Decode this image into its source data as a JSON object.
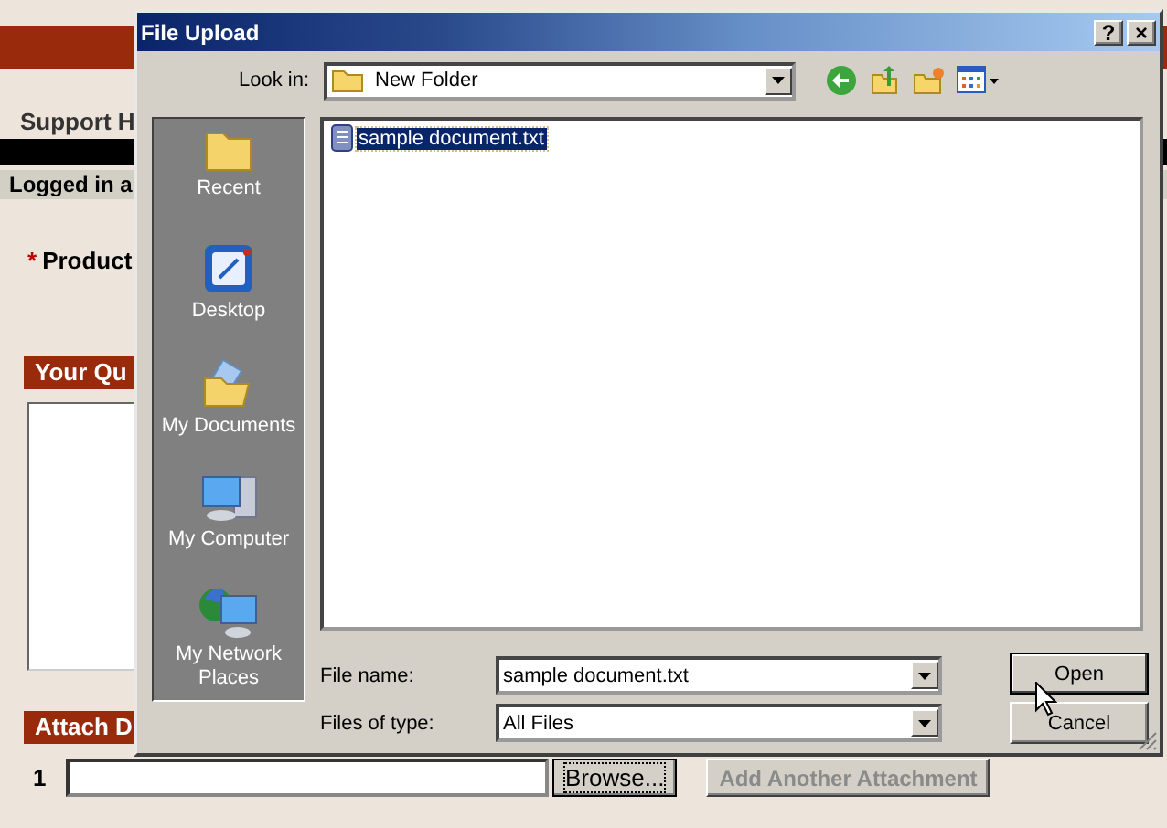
{
  "page": {
    "header": "Support H",
    "login": "Logged in a",
    "required_mark": "*",
    "product_label": "Product",
    "question_heading": "Your Qu",
    "attach_heading": "Attach D",
    "attachment_index": "1",
    "browse_button": "Browse...",
    "add_button": {
      "label": "Add Another Attachment",
      "disabled": true
    }
  },
  "dialog": {
    "title": "File Upload",
    "help_button": "?",
    "close_button": "×",
    "look_in_label": "Look in:",
    "look_in_value": "New Folder",
    "places": [
      {
        "label": "Recent",
        "kind": "recent"
      },
      {
        "label": "Desktop",
        "kind": "desktop"
      },
      {
        "label": "My Documents",
        "kind": "documents"
      },
      {
        "label": "My Computer",
        "kind": "computer"
      },
      {
        "label": "My Network Places",
        "kind": "network"
      }
    ],
    "files": [
      {
        "name": "sample document.txt",
        "selected": true
      }
    ],
    "file_name_label": "File name:",
    "file_name_value": "sample document.txt",
    "file_type_label": "Files of type:",
    "file_type_value": "All Files",
    "buttons": [
      {
        "label": "Open",
        "default": true
      },
      {
        "label": "Cancel",
        "default": false
      }
    ]
  }
}
